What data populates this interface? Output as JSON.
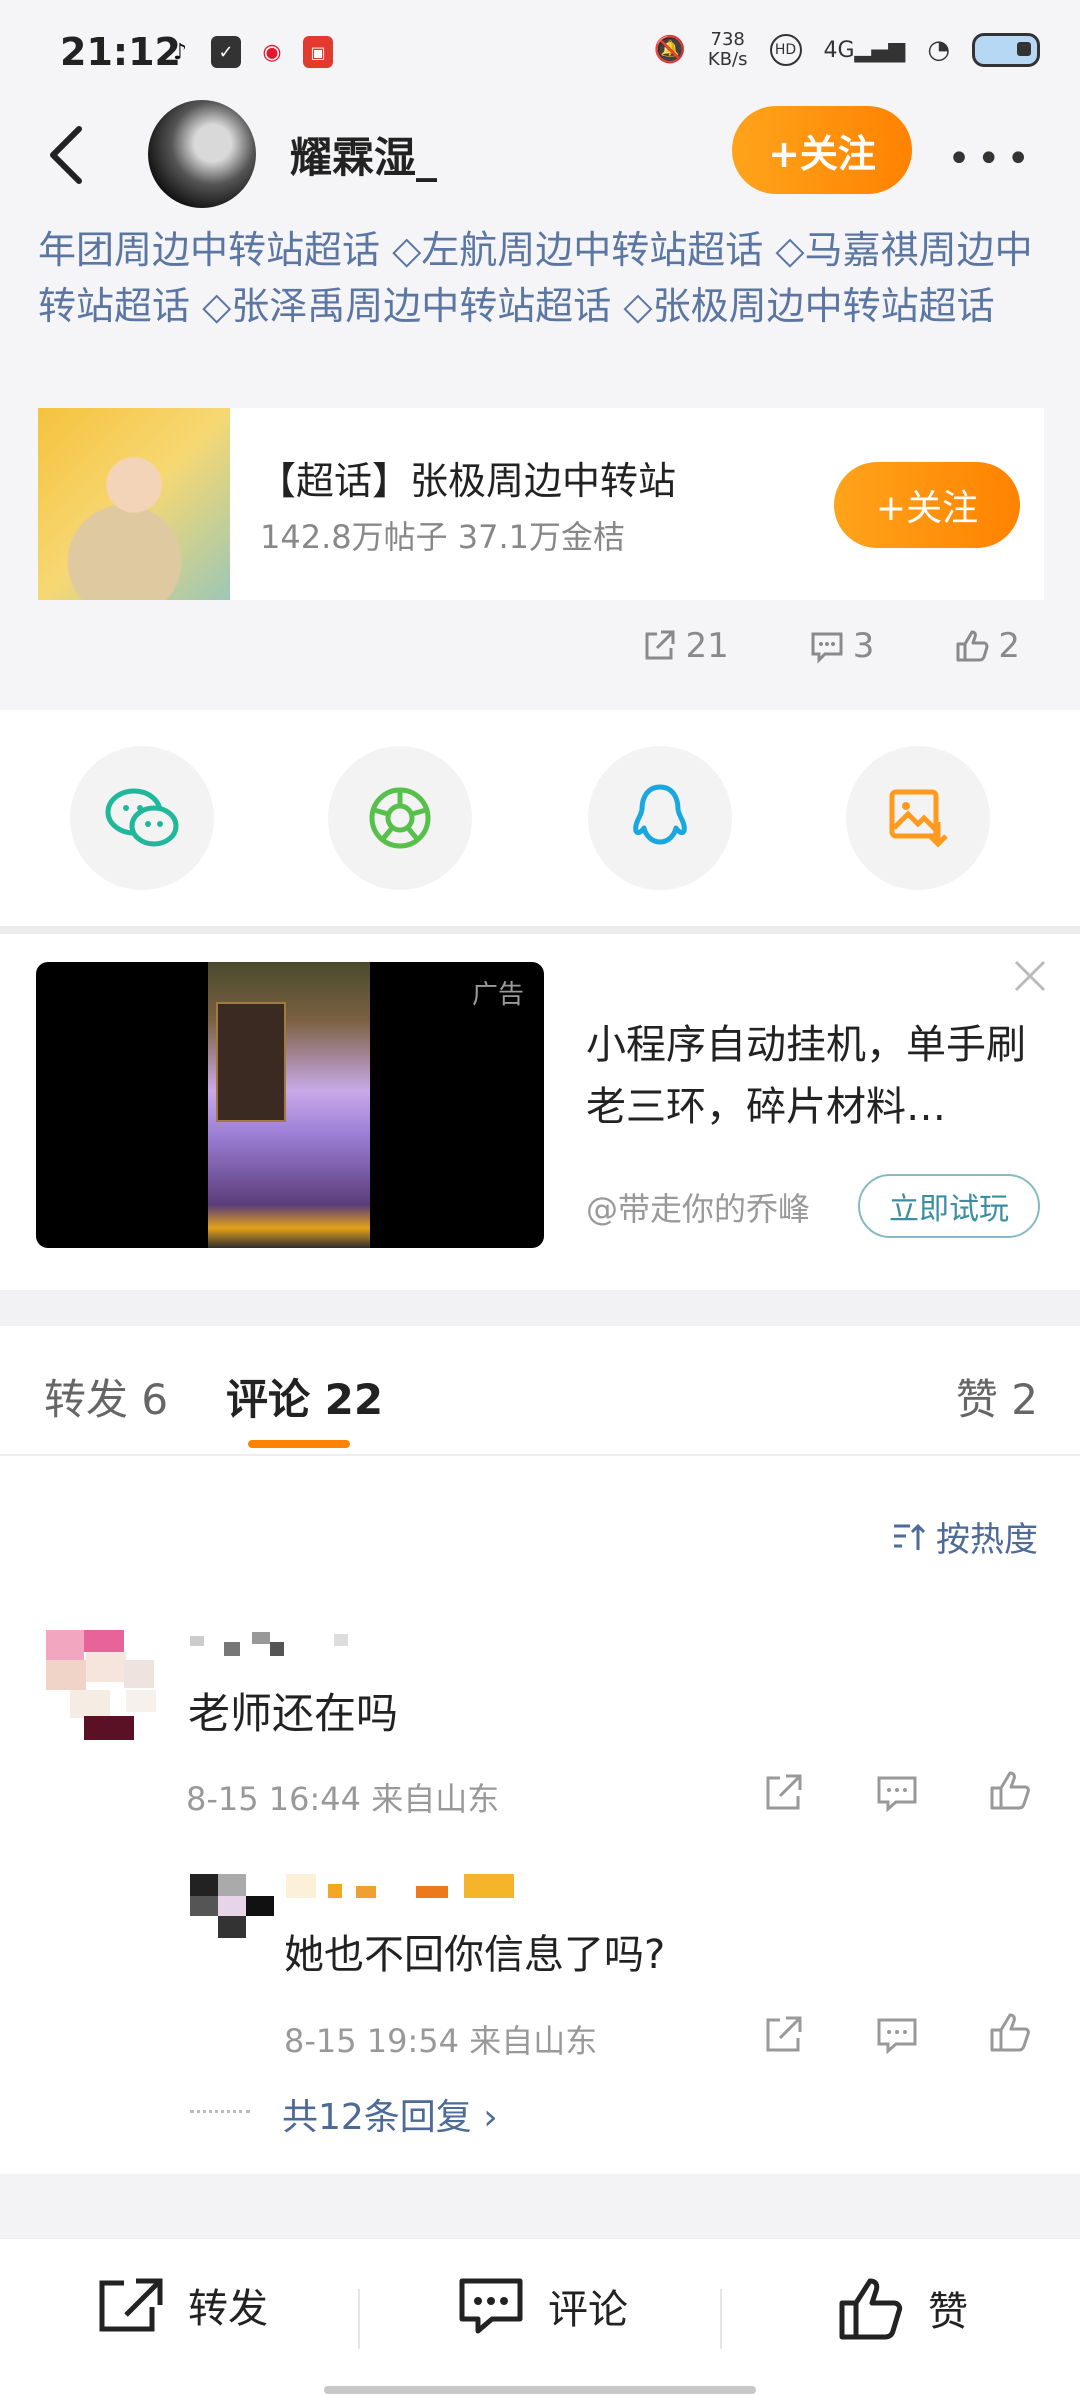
{
  "status_bar": {
    "time": "21:12",
    "net_speed_value": "738",
    "net_speed_unit": "KB/s",
    "signal_label": "4G",
    "icons": [
      "tiktok-icon",
      "clipboard-icon",
      "weibo-icon",
      "app-badge-icon",
      "mute-icon",
      "hd-icon",
      "signal-icon",
      "wifi-icon",
      "battery-icon"
    ]
  },
  "header": {
    "username": "耀霖湿_",
    "follow_label": "+关注"
  },
  "post": {
    "tags_line": "年团周边中转站超话 ◇左航周边中转站超话 ◇马嘉祺周边中转站超话 ◇张泽禹周边中转站超话 ◇张极周边中转站超话",
    "topic": {
      "title": "【超话】张极周边中转站",
      "stats": "142.8万帖子 37.1万金桔",
      "follow_label": "+关注"
    },
    "actions": {
      "repost_count": "21",
      "comment_count": "3",
      "like_count": "2"
    }
  },
  "share": {
    "items": [
      "wechat-icon",
      "moments-icon",
      "qq-icon",
      "save-image-icon"
    ],
    "colors": {
      "wechat": "#1fb89a",
      "moments": "#56c04a",
      "qq": "#19a7e0",
      "save": "#ff9a1f"
    }
  },
  "ad": {
    "label": "广告",
    "text": "小程序自动挂机，单手刷老三环，碎片材料…",
    "source": "@带走你的乔峰",
    "cta": "立即试玩"
  },
  "tabs": {
    "repost": "转发 6",
    "comments": "评论 22",
    "likes": "赞 2"
  },
  "comments": {
    "sort_label": "按热度",
    "items": [
      {
        "text": "老师还在吗",
        "meta": "8-15 16:44 来自山东",
        "reply": {
          "text": "她也不回你信息了吗?",
          "meta": "8-15 19:54 来自山东"
        }
      }
    ],
    "replies_link": "共12条回复 ›"
  },
  "bottom_bar": {
    "repost": "转发",
    "comment": "评论",
    "like": "赞"
  },
  "accent_color": "#ff8200"
}
